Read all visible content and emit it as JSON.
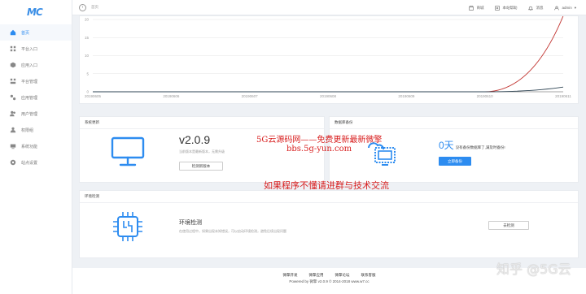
{
  "logo": "MC",
  "sidebar": {
    "items": [
      {
        "label": "首页",
        "icon": "home-icon",
        "active": true
      },
      {
        "label": "平台入口",
        "icon": "grid-icon"
      },
      {
        "label": "应用入口",
        "icon": "cube-icon"
      },
      {
        "label": "平台管理",
        "icon": "apps-icon"
      },
      {
        "label": "应用管理",
        "icon": "cubes-icon"
      },
      {
        "label": "用户管理",
        "icon": "users-icon"
      },
      {
        "label": "权限组",
        "icon": "user-group-icon"
      },
      {
        "label": "系统功能",
        "icon": "system-icon"
      },
      {
        "label": "站点设置",
        "icon": "settings-icon"
      }
    ]
  },
  "topbar": {
    "crumb": "首页",
    "links": [
      {
        "label": "商城",
        "icon": "shop-icon"
      },
      {
        "label": "本站帮助",
        "icon": "help-icon"
      },
      {
        "label": "消息",
        "icon": "bell-icon"
      },
      {
        "label": "admin",
        "icon": "user-icon"
      }
    ]
  },
  "chart_data": {
    "type": "line",
    "categories": [
      "20190605",
      "20190606",
      "20190607",
      "20190608",
      "20190609",
      "20190610",
      "20190611"
    ],
    "ylim": [
      0,
      20
    ],
    "yticks": [
      "0",
      "5",
      "10",
      "15",
      "20"
    ],
    "series": [
      {
        "color": "#c23531",
        "values": [
          0,
          0,
          0,
          0,
          0,
          0,
          21
        ]
      },
      {
        "color": "#2f4554",
        "values": [
          0,
          0,
          0,
          0,
          0,
          0,
          1.3
        ]
      }
    ]
  },
  "system": {
    "title": "系统更新",
    "version": "v2.0.9",
    "desc": "当前版本是最新版本，无需升级",
    "button": "检测新版本"
  },
  "database": {
    "title": "数据库备份",
    "days": "0天",
    "text": "没有备份数据库了,满及时备份!",
    "button": "立即备份"
  },
  "environment": {
    "title": "环境检测",
    "heading": "环境检测",
    "desc": "在使用过程中，如果出现未知错误，可以启动环境检测，避免后续出现问题",
    "button": "去检测"
  },
  "footer": {
    "links": [
      "微擎开发",
      "微擎应用",
      "微擎论坛",
      "联系客服"
    ],
    "copyright": "Powered by 微擎 v2.0.9 © 2014-2018 www.w7.cc"
  },
  "watermarks": {
    "line1": "5G云源码网——免费更新最新微擎",
    "line2": "bbs.5g-yun.com",
    "line3": "如果程序不懂请进群与技术交流",
    "corner": "知乎 @5G云"
  }
}
